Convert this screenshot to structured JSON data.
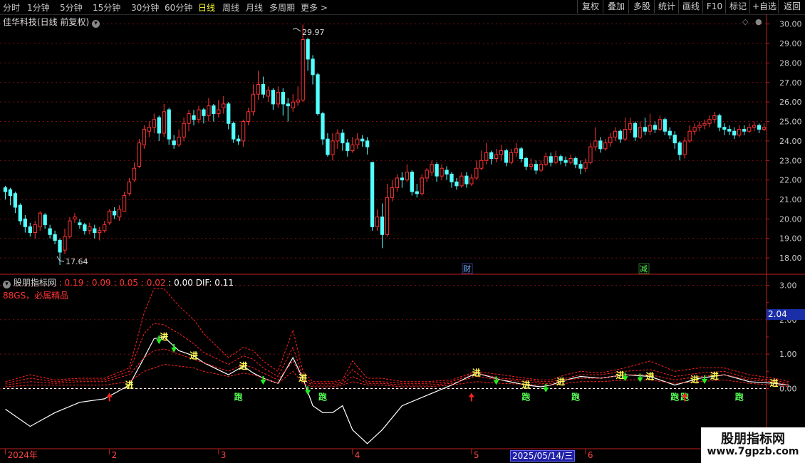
{
  "topbar": {
    "periods": [
      "分时",
      "1分钟",
      "5分钟",
      "15分钟",
      "30分钟",
      "60分钟",
      "日线",
      "周线",
      "月线",
      "多周期",
      "更多 >"
    ],
    "active_period": "日线",
    "right_buttons": [
      "复权",
      "叠加",
      "多股",
      "统计",
      "画线",
      "F10",
      "标记",
      "+自选",
      "返回"
    ]
  },
  "stock": {
    "title": "佳华科技(日线 前复权)"
  },
  "indicator": {
    "name": "股朋指标网",
    "values": [
      ": 0.19",
      ": 0.09",
      ": 0.05",
      ": 0.02",
      ": 0.00",
      "DIF: 0.11"
    ],
    "subtitle": "88GS，必属精品",
    "current_value": "2.04"
  },
  "main_axis": {
    "ticks": [
      "30.00",
      "29.00",
      "28.00",
      "27.00",
      "26.00",
      "25.00",
      "24.00",
      "23.00",
      "22.00",
      "21.00",
      "20.00",
      "19.00",
      "18.00"
    ]
  },
  "ind_axis": {
    "ticks": [
      "3.00",
      "2.00",
      "1.00",
      "0.00"
    ]
  },
  "markers": {
    "high_label": "29.97",
    "low_label": "17.64",
    "event1": "财",
    "event2": "减"
  },
  "signals": {
    "buy_text": "进",
    "run_text": "跑"
  },
  "x_axis": {
    "labels": [
      "2024年",
      "2",
      "3",
      "4",
      "5",
      "6"
    ],
    "selected_date": "2025/05/14/三"
  },
  "watermark": {
    "line1": "股朋指标网",
    "line2": "www.7gpzb.com"
  },
  "colors": {
    "up": "#ff3333",
    "down": "#54ffff",
    "dif": "#ffffff",
    "band": "#ff2020",
    "grid": "#7a1010",
    "axis": "#c02020"
  },
  "chart_data": [
    {
      "type": "candlestick",
      "title": "佳华科技(日线 前复权)",
      "ylim": [
        17.2,
        30.5
      ],
      "high": 29.97,
      "low": 17.64,
      "candles": [
        [
          21.6,
          21.4,
          21.7,
          21.0
        ],
        [
          21.5,
          21.2,
          21.6,
          20.7
        ],
        [
          21.3,
          20.6,
          21.4,
          20.3
        ],
        [
          20.7,
          19.9,
          20.8,
          19.7
        ],
        [
          20.0,
          19.6,
          20.2,
          19.3
        ],
        [
          19.6,
          19.3,
          19.8,
          19.1
        ],
        [
          19.3,
          19.7,
          19.9,
          19.0
        ],
        [
          19.6,
          20.3,
          20.4,
          19.4
        ],
        [
          20.2,
          19.7,
          20.3,
          19.5
        ],
        [
          19.5,
          19.2,
          19.7,
          19.0
        ],
        [
          19.2,
          18.9,
          19.4,
          18.7
        ],
        [
          18.9,
          18.3,
          19.0,
          17.64
        ],
        [
          18.4,
          19.1,
          19.5,
          18.2
        ],
        [
          19.1,
          19.9,
          20.1,
          19.0
        ],
        [
          20.0,
          20.1,
          20.3,
          19.8
        ],
        [
          19.8,
          19.7,
          20.0,
          19.5
        ],
        [
          19.7,
          19.4,
          19.8,
          19.2
        ],
        [
          19.4,
          19.6,
          19.8,
          19.2
        ],
        [
          19.5,
          19.3,
          19.7,
          19.0
        ],
        [
          19.3,
          19.4,
          19.6,
          18.9
        ],
        [
          19.4,
          19.7,
          19.9,
          19.3
        ],
        [
          19.8,
          20.4,
          20.5,
          19.7
        ],
        [
          20.4,
          20.2,
          20.6,
          20.0
        ],
        [
          20.1,
          20.5,
          20.7,
          19.9
        ],
        [
          20.4,
          21.2,
          21.4,
          20.4
        ],
        [
          21.3,
          21.9,
          22.1,
          21.2
        ],
        [
          22.0,
          22.6,
          22.9,
          21.9
        ],
        [
          22.7,
          23.9,
          24.1,
          22.6
        ],
        [
          23.8,
          24.6,
          24.8,
          23.6
        ],
        [
          24.5,
          24.7,
          25.0,
          24.2
        ],
        [
          24.7,
          25.1,
          25.4,
          24.4
        ],
        [
          25.2,
          24.4,
          25.3,
          24.0
        ],
        [
          24.4,
          25.5,
          25.9,
          24.2
        ],
        [
          25.6,
          24.1,
          25.7,
          23.8
        ],
        [
          24.0,
          23.8,
          24.3,
          23.6
        ],
        [
          23.8,
          24.2,
          24.6,
          23.7
        ],
        [
          24.2,
          24.9,
          25.2,
          24.0
        ],
        [
          24.9,
          25.4,
          25.6,
          24.5
        ],
        [
          25.3,
          25.1,
          25.6,
          24.8
        ],
        [
          25.1,
          25.6,
          25.8,
          24.9
        ],
        [
          25.6,
          25.3,
          25.7,
          24.9
        ],
        [
          25.3,
          25.8,
          26.2,
          25.0
        ],
        [
          25.8,
          25.4,
          25.9,
          25.0
        ],
        [
          25.4,
          25.6,
          26.1,
          25.2
        ],
        [
          25.7,
          25.9,
          26.3,
          25.4
        ],
        [
          25.9,
          24.9,
          26.0,
          24.6
        ],
        [
          24.9,
          24.1,
          25.0,
          23.9
        ],
        [
          24.1,
          24.0,
          24.3,
          23.8
        ],
        [
          24.0,
          25.0,
          25.1,
          23.7
        ],
        [
          25.0,
          25.5,
          25.7,
          24.8
        ],
        [
          25.5,
          26.4,
          26.9,
          25.3
        ],
        [
          26.4,
          26.9,
          27.6,
          26.1
        ],
        [
          26.9,
          26.4,
          27.3,
          26.2
        ],
        [
          26.3,
          26.6,
          26.8,
          26.0
        ],
        [
          26.6,
          25.9,
          26.7,
          25.6
        ],
        [
          25.9,
          26.5,
          26.8,
          25.7
        ],
        [
          26.5,
          25.9,
          26.7,
          25.3
        ],
        [
          25.9,
          25.8,
          26.2,
          25.0
        ],
        [
          25.7,
          26.0,
          26.4,
          25.5
        ],
        [
          26.0,
          26.1,
          26.8,
          25.8
        ],
        [
          26.1,
          29.2,
          29.97,
          26.0
        ],
        [
          29.2,
          28.2,
          29.3,
          27.6
        ],
        [
          28.2,
          27.4,
          28.4,
          26.9
        ],
        [
          27.4,
          25.4,
          27.5,
          25.3
        ],
        [
          25.4,
          24.1,
          25.5,
          23.8
        ],
        [
          24.1,
          23.3,
          24.4,
          23.2
        ],
        [
          23.3,
          24.0,
          24.4,
          23.0
        ],
        [
          24.0,
          24.4,
          24.6,
          23.6
        ],
        [
          24.4,
          23.9,
          24.6,
          23.5
        ],
        [
          23.9,
          23.5,
          24.1,
          23.2
        ],
        [
          23.5,
          23.8,
          24.2,
          23.4
        ],
        [
          23.8,
          24.1,
          24.4,
          23.6
        ],
        [
          24.1,
          24.0,
          24.3,
          23.7
        ],
        [
          24.0,
          23.7,
          24.2,
          23.3
        ],
        [
          22.9,
          19.6,
          22.9,
          19.4
        ],
        [
          19.6,
          20.1,
          20.5,
          19.4
        ],
        [
          20.1,
          19.2,
          20.8,
          18.5
        ],
        [
          19.2,
          21.1,
          21.8,
          19.1
        ],
        [
          21.1,
          21.6,
          22.0,
          20.9
        ],
        [
          21.6,
          22.1,
          22.3,
          21.4
        ],
        [
          22.1,
          22.0,
          22.4,
          21.6
        ],
        [
          22.0,
          22.4,
          22.8,
          21.9
        ],
        [
          22.4,
          21.4,
          22.5,
          21.2
        ],
        [
          21.4,
          21.3,
          21.8,
          21.1
        ],
        [
          21.3,
          22.1,
          22.3,
          21.2
        ],
        [
          22.1,
          22.5,
          22.6,
          21.9
        ],
        [
          22.4,
          22.8,
          23.0,
          22.2
        ],
        [
          22.8,
          22.2,
          22.9,
          21.9
        ],
        [
          22.2,
          22.6,
          22.8,
          22.0
        ],
        [
          22.5,
          22.3,
          22.7,
          22.0
        ],
        [
          22.3,
          21.9,
          22.4,
          21.6
        ],
        [
          21.9,
          21.7,
          22.1,
          21.5
        ],
        [
          21.7,
          22.2,
          22.4,
          21.6
        ],
        [
          22.2,
          21.8,
          22.4,
          21.6
        ],
        [
          21.8,
          22.1,
          22.3,
          21.7
        ],
        [
          22.1,
          22.6,
          23.0,
          22.0
        ],
        [
          22.6,
          23.0,
          23.5,
          22.5
        ],
        [
          23.0,
          23.4,
          23.9,
          22.8
        ],
        [
          23.4,
          23.1,
          23.5,
          22.8
        ],
        [
          23.1,
          23.3,
          23.6,
          22.9
        ],
        [
          23.3,
          23.5,
          23.8,
          23.0
        ],
        [
          23.5,
          22.9,
          23.6,
          22.7
        ],
        [
          22.9,
          23.4,
          23.6,
          22.8
        ],
        [
          23.4,
          23.6,
          23.9,
          23.2
        ],
        [
          23.6,
          23.1,
          23.7,
          22.9
        ],
        [
          23.1,
          22.7,
          23.2,
          22.5
        ],
        [
          22.7,
          22.8,
          23.1,
          22.5
        ],
        [
          22.8,
          22.5,
          23.0,
          22.3
        ],
        [
          22.5,
          22.8,
          23.0,
          22.4
        ],
        [
          22.8,
          23.2,
          23.4,
          22.7
        ],
        [
          23.2,
          22.9,
          23.4,
          22.7
        ],
        [
          22.9,
          23.2,
          23.5,
          22.8
        ],
        [
          23.2,
          23.0,
          23.3,
          22.8
        ],
        [
          23.0,
          22.9,
          23.2,
          22.7
        ],
        [
          22.9,
          23.1,
          23.3,
          22.8
        ],
        [
          23.1,
          22.8,
          23.2,
          22.6
        ],
        [
          22.8,
          22.6,
          23.0,
          22.3
        ],
        [
          22.6,
          22.9,
          23.1,
          22.4
        ],
        [
          22.9,
          23.7,
          23.9,
          22.8
        ],
        [
          23.7,
          24.0,
          24.7,
          23.5
        ],
        [
          24.0,
          23.6,
          24.2,
          23.4
        ],
        [
          23.6,
          23.9,
          24.1,
          23.5
        ],
        [
          23.9,
          24.2,
          24.4,
          23.7
        ],
        [
          24.2,
          24.5,
          24.7,
          24.0
        ],
        [
          24.5,
          24.1,
          24.6,
          23.9
        ],
        [
          24.1,
          24.6,
          25.2,
          24.0
        ],
        [
          24.6,
          24.9,
          25.2,
          24.4
        ],
        [
          24.9,
          24.2,
          25.0,
          24.0
        ],
        [
          24.2,
          24.7,
          25.0,
          24.1
        ],
        [
          24.7,
          24.5,
          25.2,
          24.3
        ],
        [
          24.5,
          24.8,
          25.4,
          24.3
        ],
        [
          24.8,
          24.6,
          25.0,
          24.4
        ],
        [
          24.6,
          25.1,
          25.3,
          24.5
        ],
        [
          25.1,
          24.5,
          25.2,
          24.3
        ],
        [
          24.5,
          24.3,
          24.7,
          24.1
        ],
        [
          24.3,
          23.9,
          24.5,
          23.6
        ],
        [
          23.9,
          23.3,
          24.0,
          23.0
        ],
        [
          23.3,
          24.0,
          24.2,
          23.1
        ],
        [
          24.0,
          24.5,
          24.8,
          23.9
        ],
        [
          24.5,
          24.7,
          24.9,
          24.3
        ],
        [
          24.7,
          24.8,
          25.0,
          24.5
        ],
        [
          24.8,
          24.9,
          25.1,
          24.6
        ],
        [
          24.9,
          25.1,
          25.3,
          24.7
        ],
        [
          25.1,
          25.3,
          25.5,
          24.9
        ],
        [
          25.3,
          24.7,
          25.4,
          24.5
        ],
        [
          24.7,
          24.6,
          24.9,
          24.3
        ],
        [
          24.6,
          24.5,
          24.8,
          24.3
        ],
        [
          24.5,
          24.3,
          24.7,
          24.1
        ],
        [
          24.3,
          24.6,
          24.8,
          24.2
        ],
        [
          24.6,
          24.5,
          24.8,
          24.3
        ],
        [
          24.5,
          24.7,
          24.9,
          24.4
        ],
        [
          24.7,
          24.8,
          25.0,
          24.5
        ],
        [
          24.8,
          24.6,
          24.9,
          24.4
        ],
        [
          24.6,
          24.7,
          24.9,
          24.5
        ]
      ]
    },
    {
      "type": "line",
      "title": "股朋指标网",
      "ylim": [
        -1.75,
        3.3
      ],
      "x": [
        0,
        5,
        10,
        15,
        20,
        25,
        28,
        30,
        32,
        35,
        38,
        40,
        45,
        48,
        50,
        52,
        55,
        58,
        60,
        62,
        64,
        66,
        68,
        70,
        73,
        76,
        80,
        85,
        90,
        95,
        100,
        105,
        108,
        110,
        113,
        116,
        120,
        125,
        130,
        135,
        140,
        145,
        150,
        155,
        158
      ],
      "series": [
        {
          "name": "DIF",
          "values": [
            -0.6,
            -1.1,
            -0.7,
            -0.4,
            -0.3,
            0.1,
            0.9,
            1.45,
            1.5,
            1.1,
            0.95,
            0.75,
            0.4,
            0.65,
            0.45,
            0.3,
            0.15,
            0.9,
            0.3,
            -0.5,
            -0.7,
            -0.7,
            -0.5,
            -1.2,
            -1.6,
            -1.2,
            -0.5,
            -0.2,
            0.1,
            0.45,
            0.25,
            0.1,
            0.05,
            0.1,
            0.25,
            0.35,
            0.3,
            0.4,
            0.35,
            0.1,
            0.3,
            0.4,
            0.2,
            0.15,
            0.1
          ]
        },
        {
          "name": "upper-1",
          "values": [
            0.2,
            0.4,
            0.25,
            0.3,
            0.3,
            0.6,
            2.2,
            2.9,
            2.9,
            2.4,
            2.0,
            1.6,
            0.9,
            1.2,
            1.1,
            0.8,
            0.5,
            1.7,
            0.5,
            0.2,
            0.2,
            0.2,
            0.25,
            0.8,
            0.3,
            0.3,
            0.2,
            0.2,
            0.25,
            0.5,
            0.4,
            0.3,
            0.25,
            0.25,
            0.4,
            0.5,
            0.45,
            0.6,
            0.8,
            0.5,
            0.6,
            0.6,
            0.4,
            0.3,
            0.2
          ]
        },
        {
          "name": "upper-2",
          "values": [
            0.15,
            0.3,
            0.2,
            0.25,
            0.25,
            0.5,
            1.6,
            1.9,
            1.85,
            1.6,
            1.3,
            1.05,
            0.7,
            0.95,
            0.85,
            0.6,
            0.35,
            1.2,
            0.35,
            0.15,
            0.15,
            0.15,
            0.2,
            0.55,
            0.2,
            0.2,
            0.15,
            0.15,
            0.2,
            0.45,
            0.3,
            0.25,
            0.2,
            0.2,
            0.3,
            0.4,
            0.4,
            0.5,
            0.55,
            0.35,
            0.45,
            0.5,
            0.3,
            0.25,
            0.15
          ]
        },
        {
          "name": "upper-3",
          "values": [
            0.1,
            0.2,
            0.15,
            0.2,
            0.2,
            0.4,
            0.9,
            1.1,
            1.15,
            1.0,
            0.85,
            0.75,
            0.5,
            0.7,
            0.6,
            0.45,
            0.25,
            0.8,
            0.25,
            0.1,
            0.1,
            0.1,
            0.15,
            0.35,
            0.15,
            0.15,
            0.1,
            0.1,
            0.15,
            0.35,
            0.25,
            0.2,
            0.15,
            0.15,
            0.25,
            0.3,
            0.3,
            0.4,
            0.4,
            0.25,
            0.35,
            0.4,
            0.25,
            0.2,
            0.1
          ]
        },
        {
          "name": "upper-4",
          "values": [
            0.05,
            0.1,
            0.1,
            0.1,
            0.1,
            0.2,
            0.5,
            0.6,
            0.7,
            0.65,
            0.6,
            0.5,
            0.35,
            0.45,
            0.4,
            0.3,
            0.15,
            0.5,
            0.15,
            0.05,
            0.05,
            0.05,
            0.1,
            0.2,
            0.1,
            0.1,
            0.05,
            0.05,
            0.1,
            0.2,
            0.15,
            0.12,
            0.1,
            0.1,
            0.15,
            0.2,
            0.2,
            0.25,
            0.25,
            0.15,
            0.2,
            0.25,
            0.15,
            0.1,
            0.05
          ]
        }
      ]
    }
  ]
}
